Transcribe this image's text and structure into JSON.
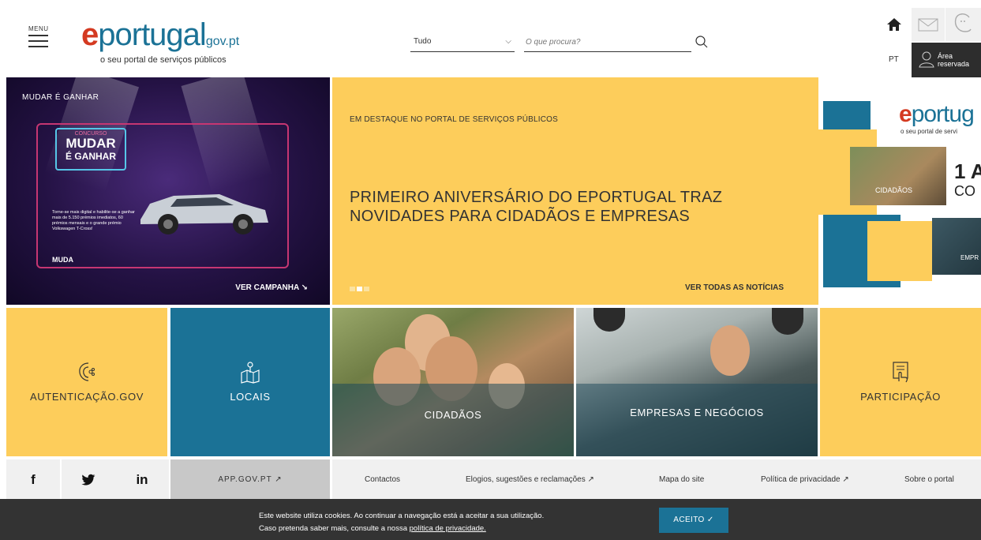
{
  "header": {
    "menu_label": "MENU",
    "logo": {
      "e": "e",
      "word": "portugal",
      "domain": "gov.pt",
      "tagline": "o seu portal de serviços públicos"
    },
    "search": {
      "category": "Tudo",
      "placeholder": "O que procura?"
    },
    "language": "PT",
    "reserved_area": {
      "line1": "Área",
      "line2": "reservada"
    }
  },
  "hero": {
    "campaign": {
      "tag": "MUDAR É GANHAR",
      "cta": "VER CAMPANHA ↘",
      "sign_small": "CONCURSO",
      "sign_big1": "MUDAR",
      "sign_big2": "É GANHAR",
      "promo": "Torne-se mais digital e habilite-se a ganhar mais de 5.150 prémios imediatos, 60 prémios mensais e o grande prémio Volkswagen T-Cross!",
      "brand": "MUDA"
    },
    "featured": {
      "kicker": "EM DESTAQUE NO PORTAL DE SERVIÇOS PÚBLICOS",
      "title": "PRIMEIRO ANIVERSÁRIO DO EPORTUGAL TRAZ NOVIDADES PARA CIDADÃOS E EMPRESAS",
      "news_cta": "VER TODAS AS NOTÍCIAS",
      "slides": 3,
      "active_slide": 2
    },
    "preview": {
      "logo_word": "portug",
      "tagline": "o seu portal de servi",
      "big1": "1 A",
      "big2": "CO",
      "label1": "CIDADÃOS",
      "label2": "EMPR"
    }
  },
  "tiles": [
    {
      "label": "AUTENTICAÇÃO.GOV",
      "icon": "fingerprint-icon"
    },
    {
      "label": "LOCAIS",
      "icon": "map-pin-icon"
    },
    {
      "label": "CIDADÃOS",
      "icon": ""
    },
    {
      "label": "EMPRESAS E NEGÓCIOS",
      "icon": ""
    },
    {
      "label": "PARTICIPAÇÃO",
      "icon": "form-hand-icon"
    }
  ],
  "social": {
    "facebook": "f",
    "twitter": "twitter-icon",
    "linkedin": "in"
  },
  "app_gov": "APP.GOV.PT ↗",
  "footer_links": [
    "Contactos",
    "Elogios, sugestões e reclamações ↗",
    "Mapa do site",
    "Política de privacidade ↗",
    "Sobre o portal"
  ],
  "cookie": {
    "line1": "Este website utiliza cookies. Ao continuar a navegação está a aceitar a sua utilização.",
    "line2_prefix": "Caso pretenda saber mais, consulte a nossa ",
    "line2_link": "política de privacidade.",
    "accept": "ACEITO"
  },
  "colors": {
    "yellow": "#fdcd5b",
    "blue": "#1b7296",
    "red": "#d43a21",
    "dark": "#333333"
  }
}
